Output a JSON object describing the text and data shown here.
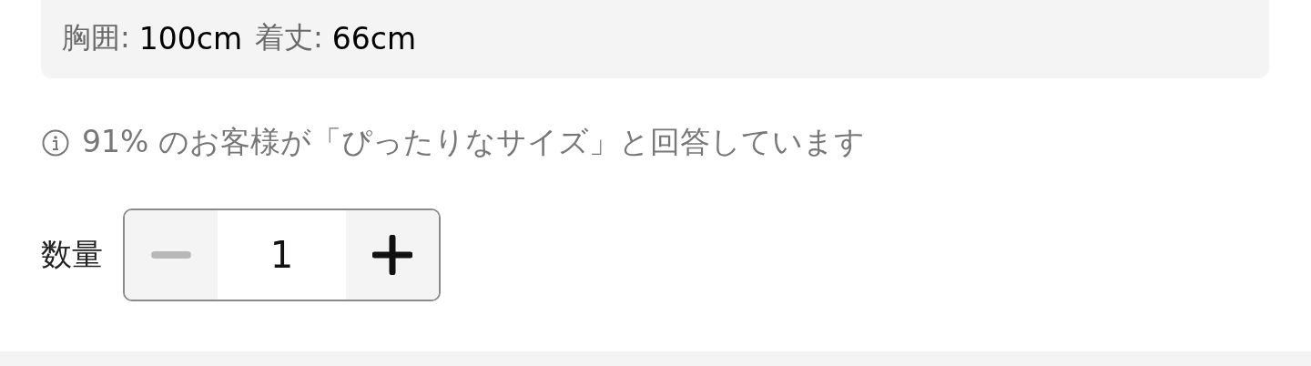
{
  "measurements": [
    {
      "label": "胸囲:",
      "value": "100cm"
    },
    {
      "label": "着丈:",
      "value": "66cm"
    }
  ],
  "fit_note": "91% のお客様が「ぴったりなサイズ」と回答しています",
  "quantity": {
    "label": "数量",
    "value": "1",
    "decrease_disabled": true,
    "increase_disabled": false
  }
}
